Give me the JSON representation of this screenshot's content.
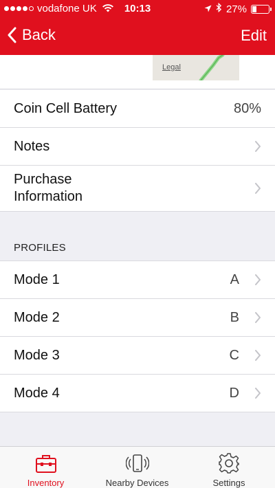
{
  "status_bar": {
    "carrier": "vodafone UK",
    "time": "10:13",
    "battery": "27%"
  },
  "nav": {
    "back_label": "Back",
    "edit_label": "Edit"
  },
  "map": {
    "legal_label": "Legal"
  },
  "details": [
    {
      "label": "Coin Cell Battery",
      "value": "80%"
    },
    {
      "label": "Notes"
    },
    {
      "label": "Purchase\nInformation"
    }
  ],
  "profiles": {
    "header": "PROFILES",
    "items": [
      {
        "label": "Mode 1",
        "value": "A"
      },
      {
        "label": "Mode 2",
        "value": "B"
      },
      {
        "label": "Mode 3",
        "value": "C"
      },
      {
        "label": "Mode 4",
        "value": "D"
      }
    ]
  },
  "tab_bar": {
    "tabs": [
      {
        "label": "Inventory",
        "icon": "toolbox-icon",
        "active": true
      },
      {
        "label": "Nearby Devices",
        "icon": "phone-signal-icon",
        "active": false
      },
      {
        "label": "Settings",
        "icon": "gear-icon",
        "active": false
      }
    ]
  },
  "colors": {
    "accent": "#e0101e",
    "background": "#efeff4"
  }
}
